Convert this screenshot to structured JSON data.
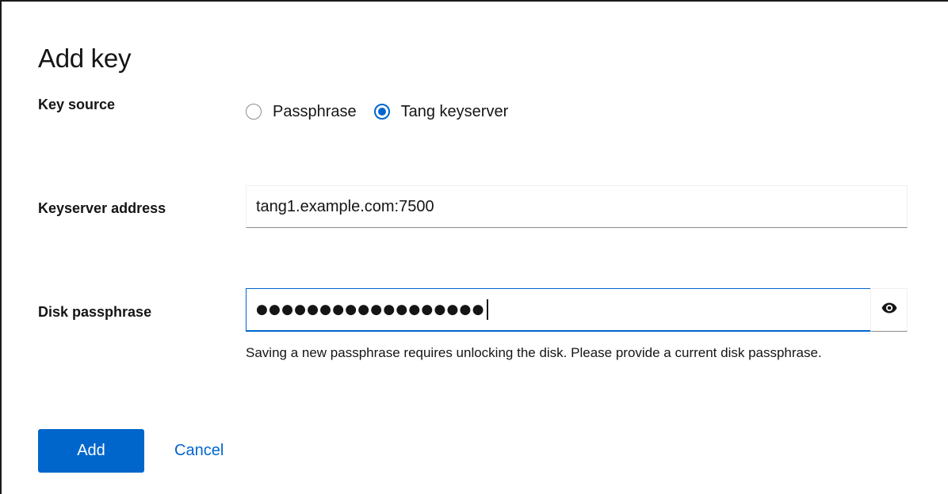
{
  "dialog": {
    "title": "Add key"
  },
  "key_source": {
    "label": "Key source",
    "options": [
      {
        "label": "Passphrase",
        "checked": false
      },
      {
        "label": "Tang keyserver",
        "checked": true
      }
    ]
  },
  "keyserver": {
    "label": "Keyserver address",
    "value": "tang1.example.com:7500"
  },
  "disk_passphrase": {
    "label": "Disk passphrase",
    "masked_value": "●●●●●●●●●●●●●●●●●●",
    "toggle_icon": "eye-icon",
    "helper_text": "Saving a new passphrase requires unlocking the disk. Please provide a current disk passphrase."
  },
  "actions": {
    "add_label": "Add",
    "cancel_label": "Cancel"
  },
  "colors": {
    "primary": "#0066cc",
    "text": "#151515",
    "input_border": "#8a8d90"
  }
}
